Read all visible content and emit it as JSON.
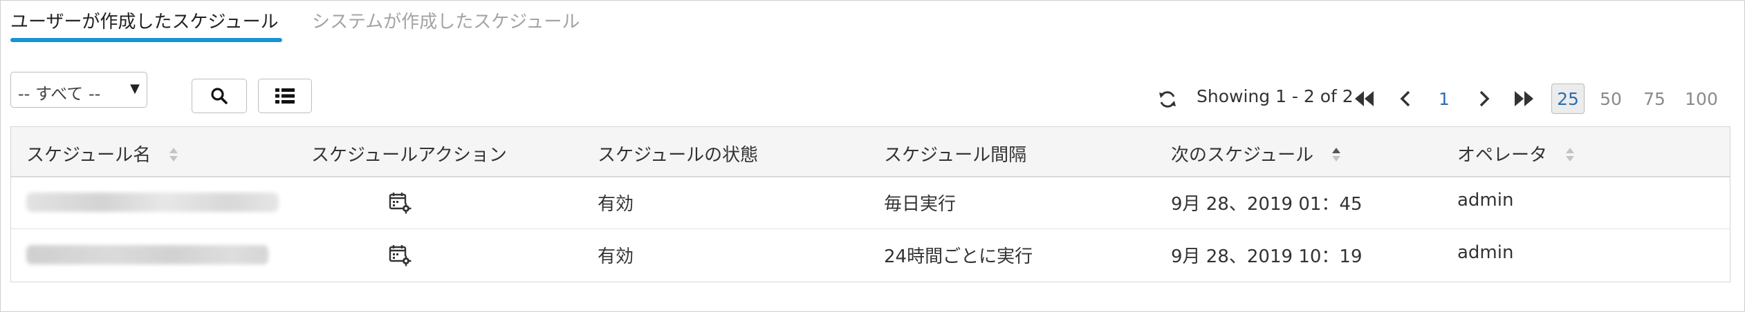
{
  "tabs": [
    {
      "label": "ユーザーが作成したスケジュール",
      "active": true
    },
    {
      "label": "システムが作成したスケジュール",
      "active": false
    }
  ],
  "accent_color": "#1a93d6",
  "filter": {
    "selected": "-- すべて --"
  },
  "toolbar": {
    "search_icon": "search-icon",
    "columns_icon": "list-icon"
  },
  "pagination": {
    "showing": "Showing 1 - 2 of 2",
    "current_page": "1",
    "page_sizes": [
      "25",
      "50",
      "75",
      "100"
    ],
    "selected_size": "25"
  },
  "table": {
    "columns": [
      "スケジュール名",
      "スケジュールアクション",
      "スケジュールの状態",
      "スケジュール間隔",
      "次のスケジュール",
      "オペレータ"
    ],
    "rows": [
      {
        "action_icon": "calendar-gear-icon",
        "state": "有効",
        "interval": "毎日実行",
        "next": "9月 28、2019 01：45",
        "operator": "admin"
      },
      {
        "action_icon": "calendar-gear-icon",
        "state": "有効",
        "interval": "24時間ごとに実行",
        "next": "9月 28、2019 10：19",
        "operator": "admin"
      }
    ]
  }
}
